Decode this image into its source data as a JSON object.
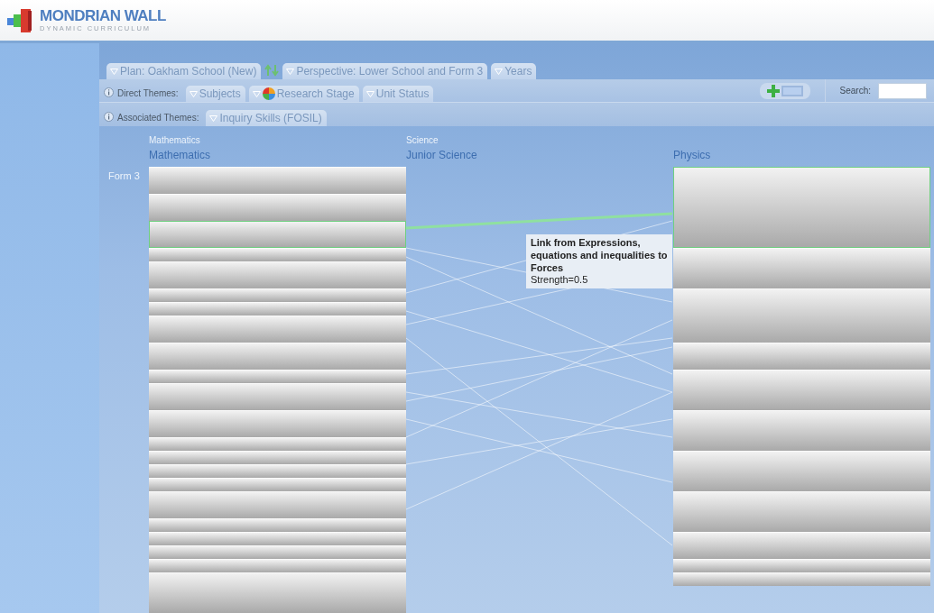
{
  "header": {
    "title": "MONDRIAN WALL",
    "subtitle": "DYNAMIC CURRICULUM"
  },
  "plan_bar": [
    {
      "kind": "tab",
      "label": "Plan: Oakham School (New)"
    },
    {
      "kind": "swap"
    },
    {
      "kind": "tab",
      "label": "Perspective: Lower School and Form 3"
    },
    {
      "kind": "tab",
      "label": "Years"
    }
  ],
  "direct_themes": {
    "label": "Direct Themes:",
    "tabs": [
      {
        "kind": "plain",
        "label": "Subjects"
      },
      {
        "kind": "pie",
        "label": "Research Stage"
      },
      {
        "kind": "plain",
        "label": "Unit Status"
      }
    ]
  },
  "search": {
    "label": "Search:"
  },
  "associated_themes": {
    "label": "Associated Themes:",
    "tabs": [
      {
        "label": "Inquiry Skills (FOSIL)"
      }
    ]
  },
  "row_label": "Form 3",
  "columns": [
    {
      "kind": "units",
      "group": "Mathematics",
      "name": "Mathematics",
      "units": [
        {
          "kind": "regular",
          "selected": false
        },
        {
          "kind": "regular",
          "selected": false
        },
        {
          "kind": "regular",
          "selected": true
        },
        {
          "kind": "short",
          "selected": false
        },
        {
          "kind": "regular",
          "selected": false
        },
        {
          "kind": "short",
          "selected": false
        },
        {
          "kind": "short",
          "selected": false
        },
        {
          "kind": "regular",
          "selected": false
        },
        {
          "kind": "regular",
          "selected": false
        },
        {
          "kind": "short",
          "selected": false
        },
        {
          "kind": "regular",
          "selected": false
        },
        {
          "kind": "regular",
          "selected": false
        },
        {
          "kind": "short",
          "selected": false
        },
        {
          "kind": "short",
          "selected": false
        },
        {
          "kind": "short",
          "selected": false
        },
        {
          "kind": "short",
          "selected": false
        },
        {
          "kind": "regular",
          "selected": false
        },
        {
          "kind": "short",
          "selected": false
        },
        {
          "kind": "short",
          "selected": false
        },
        {
          "kind": "short",
          "selected": false
        },
        {
          "kind": "short",
          "selected": false
        },
        {
          "kind": "tall",
          "selected": false
        }
      ]
    },
    {
      "kind": "links",
      "group": "Science",
      "name": "Junior Science"
    },
    {
      "kind": "units",
      "name": "Physics",
      "units": [
        {
          "kind": "tallest",
          "selected": true
        },
        {
          "kind": "tall",
          "selected": false
        },
        {
          "kind": "taller",
          "selected": false
        },
        {
          "kind": "regular",
          "selected": false
        },
        {
          "kind": "tall",
          "selected": false
        },
        {
          "kind": "tall",
          "selected": false
        },
        {
          "kind": "tall",
          "selected": false
        },
        {
          "kind": "tall",
          "selected": false
        },
        {
          "kind": "regular",
          "selected": false
        },
        {
          "kind": "short",
          "selected": false
        },
        {
          "kind": "short",
          "selected": false
        }
      ]
    }
  ],
  "tooltip": {
    "title": "Link from Expressions, equations and inequalities to Forces",
    "detail": "Strength=0.5"
  }
}
